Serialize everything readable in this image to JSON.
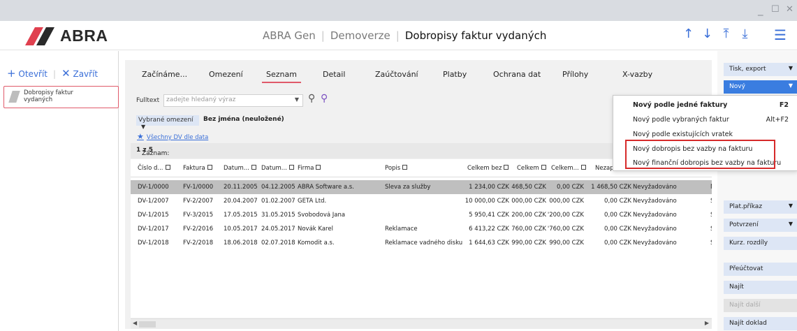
{
  "window": {
    "controls": [
      "_",
      "☐",
      "✕"
    ]
  },
  "header": {
    "logo": "ABRA",
    "crumbs": [
      "ABRA Gen",
      "Demoverze",
      "Dobropisy faktur vydaných"
    ],
    "nav_icons": [
      "arrow-up-icon",
      "arrow-down-icon",
      "arrow-first-icon",
      "arrow-last-icon",
      "hamburger-icon"
    ],
    "accent": "#3a6fd8"
  },
  "left": {
    "open_label": "Otevřít",
    "close_label": "Zavřít",
    "item_line1": "Dobropisy faktur",
    "item_line2": "vydaných"
  },
  "tabs": [
    {
      "label": "Začínáme..."
    },
    {
      "label": "Omezení"
    },
    {
      "label": "Seznam"
    },
    {
      "label": "Detail"
    },
    {
      "label": "Zaúčtování"
    },
    {
      "label": "Platby"
    },
    {
      "label": "Ochrana dat"
    },
    {
      "label": "Přílohy"
    },
    {
      "label": "X-vazby"
    }
  ],
  "filter": {
    "fulltext_label": "Fulltext",
    "fulltext_placeholder": "zadejte hledaný výraz",
    "omezeni_label": "Vybrané omezení",
    "omezeni_value": "Bez jména (neuložené)",
    "all_link": "Všechny DV dle data",
    "zaznam_label": "Záznam:",
    "zaznam_value": "1 z 5"
  },
  "grid": {
    "columns": [
      "Číslo d...",
      "Faktura",
      "Datum...",
      "Datum...",
      "Firma",
      "Popis",
      "Celkem bez",
      "Celkem",
      "Celkem...",
      "Nezaplac..."
    ],
    "rows": [
      [
        "DV-1/0000",
        "FV-1/0000",
        "20.11.2005",
        "04.12.2005",
        "ABRA Software a.s.",
        "Sleva za služby",
        "1 234,00 CZK",
        "468,50 CZK",
        "0,00 CZK",
        "1 468,50 CZK",
        "Nevyžadováno",
        "Ma"
      ],
      [
        "DV-1/2007",
        "FV-2/2007",
        "20.04.2007",
        "01.02.2007",
        "GETA Ltd.",
        "",
        "10 000,00 CZK",
        "000,00 CZK",
        "000,00 CZK",
        "0,00 CZK",
        "Nevyžadováno",
        "Sup"
      ],
      [
        "DV-1/2015",
        "FV-3/2015",
        "17.05.2015",
        "31.05.2015",
        "Svobodová Jana",
        "",
        "5 950,41 CZK",
        "200,00 CZK",
        "'200,00 CZK",
        "0,00 CZK",
        "Nevyžadováno",
        "Sup"
      ],
      [
        "DV-1/2017",
        "FV-2/2016",
        "10.05.2017",
        "24.05.2017",
        "Novák Karel",
        "Reklamace",
        "6 413,22 CZK",
        "760,00 CZK",
        "'760,00 CZK",
        "0,00 CZK",
        "Nevyžadováno",
        "Sup"
      ],
      [
        "DV-1/2018",
        "FV-2/2018",
        "18.06.2018",
        "02.07.2018",
        "Komodit a.s.",
        "Reklamace vadného disku",
        "1 644,63 CZK",
        "990,00 CZK",
        "990,00 CZK",
        "0,00 CZK",
        "Nevyžadováno",
        "Sup"
      ]
    ]
  },
  "right": {
    "tisk": "Tisk, export",
    "novy": "Nový",
    "plat": "Plat.příkaz",
    "potvrzeni": "Potvrzení",
    "kurz": "Kurz. rozdíly",
    "preuctovat": "Přeúčtovat",
    "najit": "Najít",
    "najit_dalsi": "Najít další",
    "najit_doklad": "Najít doklad",
    "more": ">"
  },
  "menu": {
    "items": [
      {
        "label": "Nový podle jedné faktury",
        "shortcut": "F2"
      },
      {
        "label": "Nový podle vybraných faktur",
        "shortcut": "Alt+F2"
      },
      {
        "label": "Nový podle existujících vratek",
        "shortcut": ""
      },
      {
        "label": "Nový dobropis bez vazby na fakturu",
        "shortcut": ""
      },
      {
        "label": "Nový finanční dobropis bez vazby na fakturu",
        "shortcut": ""
      }
    ],
    "highlight_color": "#d62a2a"
  }
}
